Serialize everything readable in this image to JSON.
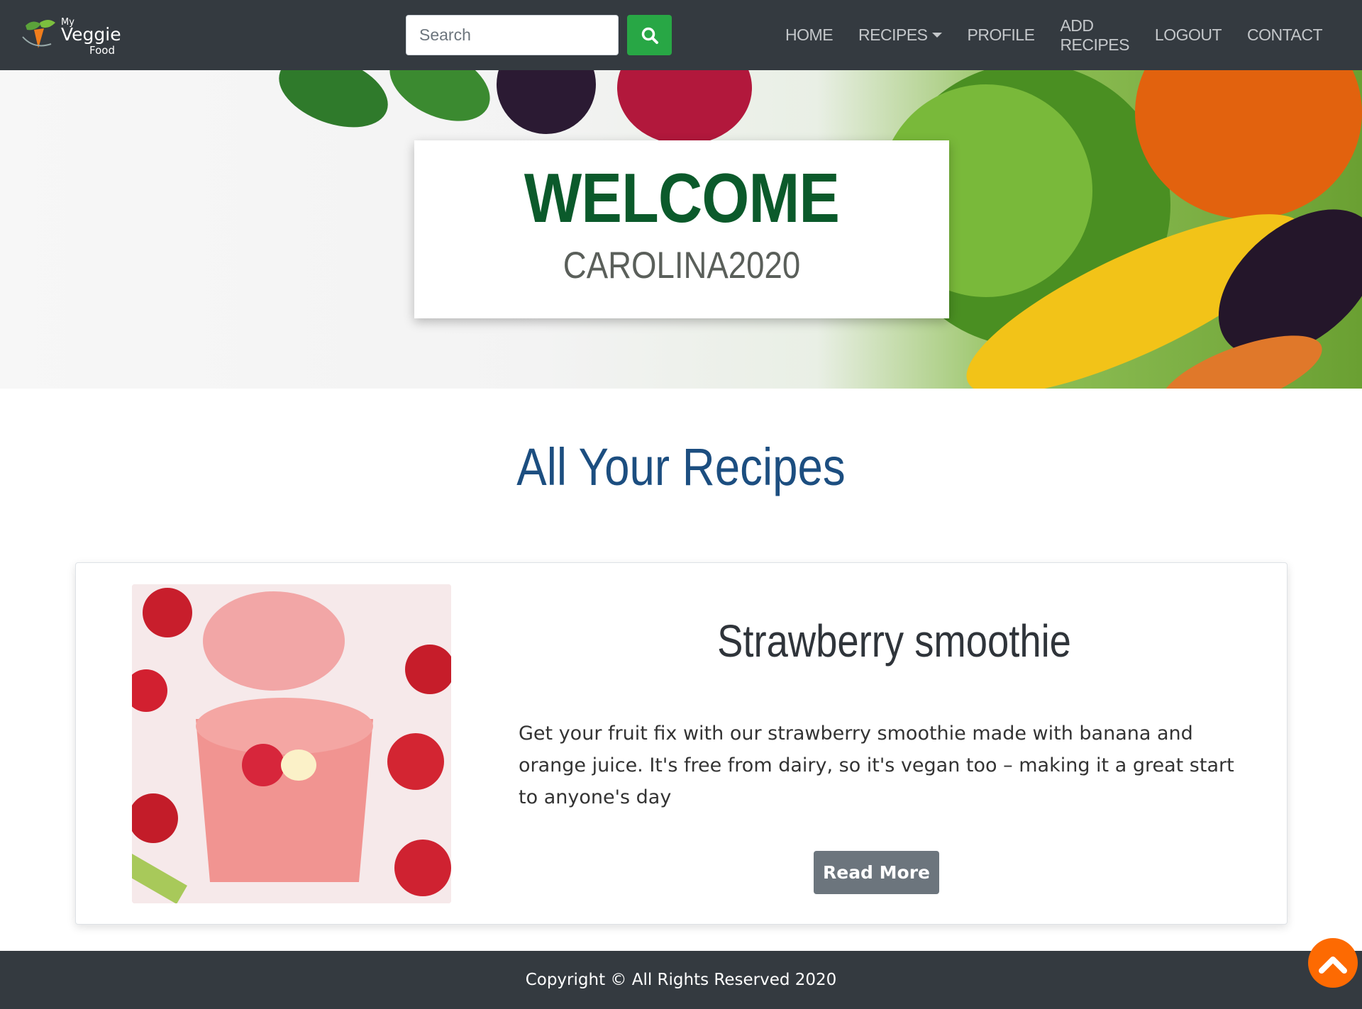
{
  "brand": {
    "line1": "My",
    "line2": "Veggie",
    "line3": "Food",
    "colors": {
      "navbar": "#343a40",
      "search_button": "#28a745",
      "welcome": "#0b5a2b",
      "section_title": "#1c4e80",
      "scroll_top": "#fd6a02"
    }
  },
  "search": {
    "placeholder": "Search",
    "button_icon": "search-icon"
  },
  "nav": {
    "items": [
      {
        "label": "HOME"
      },
      {
        "label": "RECIPES",
        "dropdown": true
      },
      {
        "label": "PROFILE"
      },
      {
        "label": "ADD RECIPES"
      },
      {
        "label": "LOGOUT"
      },
      {
        "label": "CONTACT"
      }
    ]
  },
  "hero": {
    "title": "WELCOME",
    "username": "CAROLINA2020"
  },
  "section": {
    "title": "All Your Recipes"
  },
  "recipes": [
    {
      "title": "Strawberry smoothie",
      "description": "Get your fruit fix with our strawberry smoothie made with banana and orange juice. It's free from dairy, so it's vegan too – making it a great start to anyone's day",
      "button_label": "Read More"
    }
  ],
  "footer": {
    "text": "Copyright © All Rights Reserved 2020"
  },
  "scroll_top": {
    "icon": "chevron-up-icon"
  }
}
